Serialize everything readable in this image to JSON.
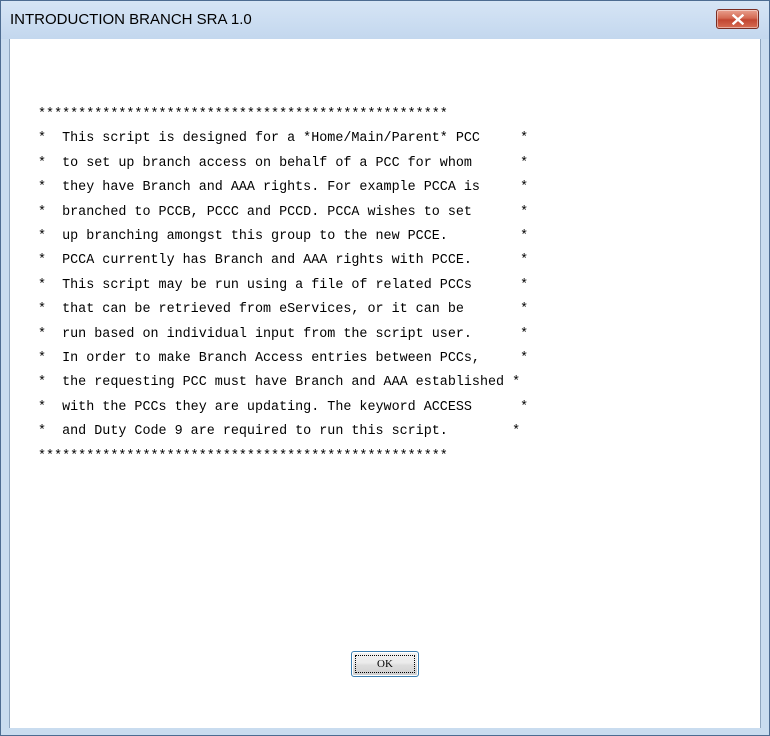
{
  "window": {
    "title": "INTRODUCTION BRANCH SRA 1.0"
  },
  "titlebar": {
    "close_icon": "close-icon"
  },
  "message": {
    "lines": [
      "***************************************************",
      "*  This script is designed for a *Home/Main/Parent* PCC     *",
      "*  to set up branch access on behalf of a PCC for whom      *",
      "*  they have Branch and AAA rights. For example PCCA is     *",
      "*  branched to PCCB, PCCC and PCCD. PCCA wishes to set      *",
      "*  up branching amongst this group to the new PCCE.         *",
      "*  PCCA currently has Branch and AAA rights with PCCE.      *",
      "*  This script may be run using a file of related PCCs      *",
      "*  that can be retrieved from eServices, or it can be       *",
      "*  run based on individual input from the script user.      *",
      "*  In order to make Branch Access entries between PCCs,     *",
      "*  the requesting PCC must have Branch and AAA established *",
      "*  with the PCCs they are updating. The keyword ACCESS      *",
      "*  and Duty Code 9 are required to run this script.        *",
      "***************************************************"
    ]
  },
  "buttons": {
    "ok_label": "OK"
  },
  "colors": {
    "frame": "#c9dcef",
    "close_button": "#c24631",
    "ok_border": "#3c7fb1"
  }
}
